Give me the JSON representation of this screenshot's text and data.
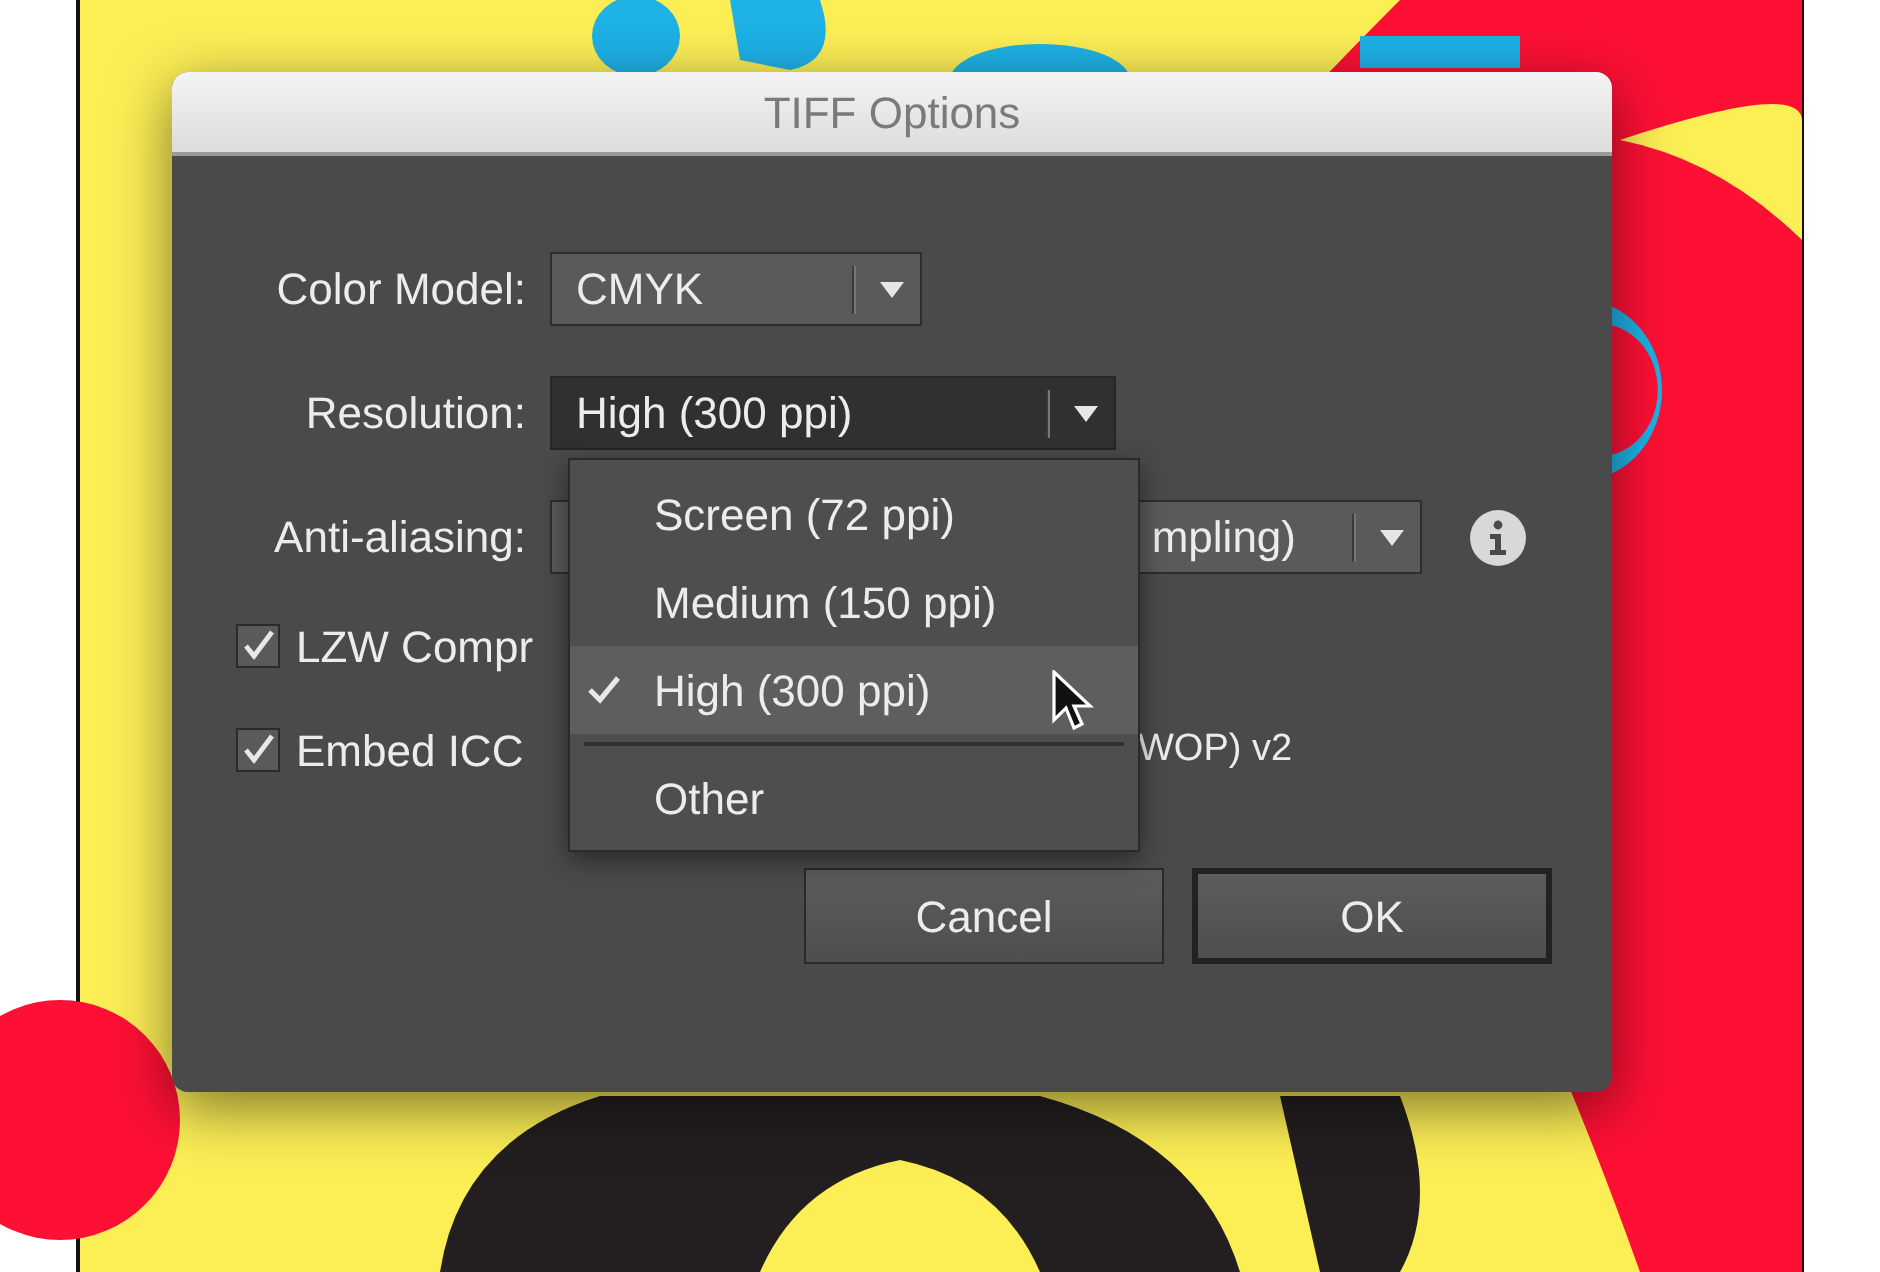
{
  "dialog": {
    "title": "TIFF Options",
    "fields": [
      {
        "label": "Color Model:",
        "value": "CMYK",
        "focused": false
      },
      {
        "label": "Resolution:",
        "value": "High (300 ppi)",
        "focused": true
      },
      {
        "label": "Anti-aliasing:",
        "value": "mpling)",
        "focused": false
      }
    ],
    "checkboxes": [
      {
        "label": "LZW Compr",
        "checked": true
      },
      {
        "label": "Embed ICC",
        "checked": true,
        "suffix": "WOP) v2"
      }
    ],
    "menu": {
      "items": [
        {
          "kind": "option",
          "label": "Screen (72 ppi)",
          "selected": false
        },
        {
          "kind": "option",
          "label": "Medium (150 ppi)",
          "selected": false
        },
        {
          "kind": "option",
          "label": "High (300 ppi)",
          "selected": true
        },
        {
          "kind": "separator"
        },
        {
          "kind": "option",
          "label": "Other",
          "selected": false
        }
      ]
    },
    "buttons": [
      {
        "label": "Cancel",
        "default": false
      },
      {
        "label": "OK",
        "default": true
      }
    ]
  }
}
